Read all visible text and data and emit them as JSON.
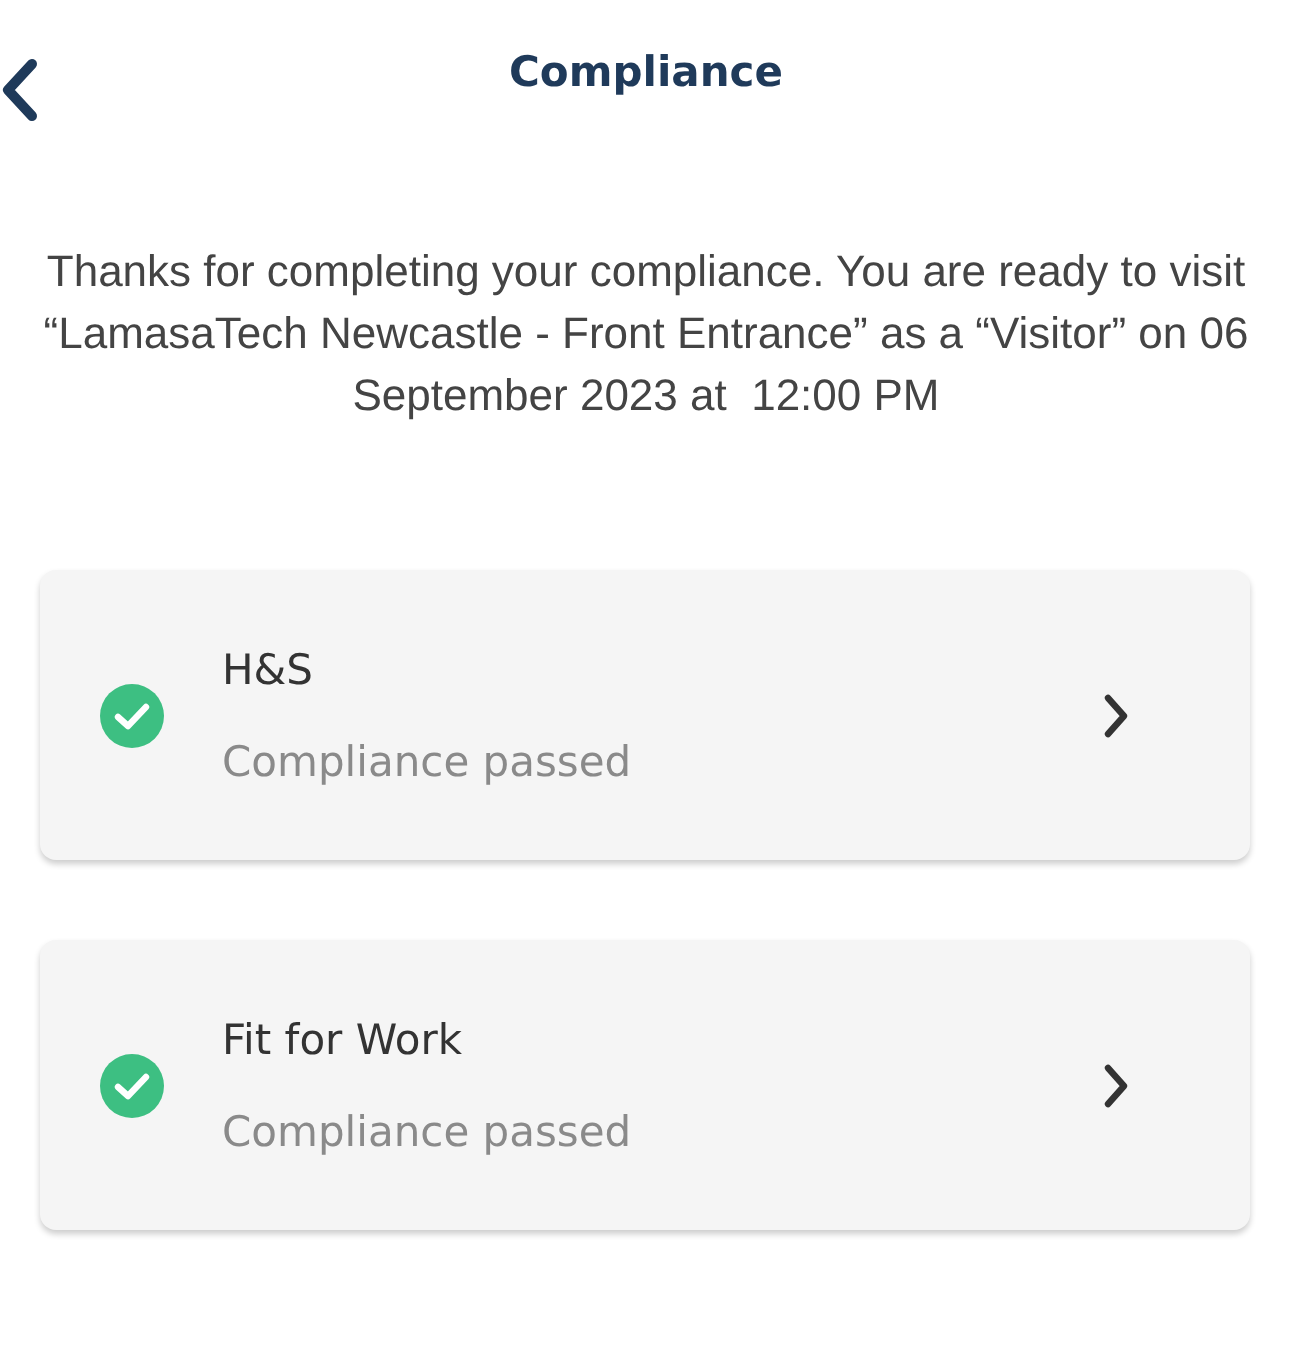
{
  "header": {
    "title": "Compliance"
  },
  "message": "Thanks for completing your compliance. You are ready to visit “LamasaTech Newcastle - Front Entrance” as a “Visitor” on 06 September 2023 at  12:00 PM",
  "items": [
    {
      "title": "H&S",
      "status": "Compliance passed",
      "passed": true
    },
    {
      "title": "Fit for Work",
      "status": "Compliance passed",
      "passed": true
    }
  ]
}
